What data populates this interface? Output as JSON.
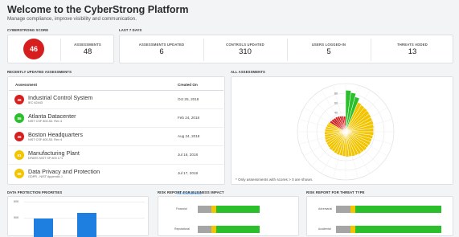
{
  "header": {
    "title": "Welcome to the CyberStrong Platform",
    "subtitle": "Manage compliance, improve visibility and communication."
  },
  "score_card": {
    "label": "CYBERSTRONG SCORE",
    "score": "46",
    "score_color": "#d71e1e",
    "assessments_label": "ASSESSMENTS",
    "assessments_value": "48"
  },
  "last7": {
    "label": "LAST 7 DAYS",
    "stats": [
      {
        "label": "ASSESSMENTS UPDATED",
        "value": "6"
      },
      {
        "label": "CONTROLS UPDATED",
        "value": "310"
      },
      {
        "label": "USERS LOGGED-IN",
        "value": "5"
      },
      {
        "label": "THREATS ADDED",
        "value": "13"
      }
    ]
  },
  "recent": {
    "label": "RECENTLY UPDATED ASSESSMENTS",
    "col_assessment": "Assessment",
    "col_created": "Created On",
    "rows": [
      {
        "score": "36",
        "color": "#d71e1e",
        "name": "Industrial Control System",
        "framework": "IEC 62443",
        "date": "Oct 25, 2018"
      },
      {
        "score": "86",
        "color": "#2bbf2b",
        "name": "Atlanta Datacenter",
        "framework": "NIST CSF 800-53. Rev 4",
        "date": "Feb 24, 2018"
      },
      {
        "score": "36",
        "color": "#d71e1e",
        "name": "Boston Headquarters",
        "framework": "NIST CSF 800-53. Rev 4",
        "date": "Aug 24, 2018"
      },
      {
        "score": "61",
        "color": "#f2c500",
        "name": "Manufacturing Plant",
        "framework": "DFARS NIST SP 800 171",
        "date": "Jul 16, 2018"
      },
      {
        "score": "66",
        "color": "#f2c500",
        "name": "Data Privacy and Protection",
        "framework": "GDPR - NIST Appendix J",
        "date": "Jul 17, 2018"
      }
    ]
  },
  "all_assessments": {
    "label": "ALL ASSESSMENTS",
    "note": "* Only assessments with scores > 0 are shown.",
    "ticks": [
      "80",
      "60",
      "40",
      "20"
    ],
    "colors": {
      "green": "#2bbf2b",
      "yellow": "#f2c500",
      "red": "#d71e1e"
    }
  },
  "bottom": {
    "data_protection_label": "DATA PROTECTION PRIORITIES",
    "risk_business_label": "RISK REPORT FOR BUSINESS IMPACT",
    "risk_business_link": "All Assessments",
    "risk_threat_label": "RISK REPORT FOR THREAT TYPE",
    "dp_ticks": [
      "60K",
      "50K"
    ],
    "business_rows": [
      "Financial",
      "Reputational"
    ],
    "threat_rows": [
      "Adversarial",
      "Accidental"
    ]
  },
  "chart_data": [
    {
      "type": "bar",
      "title": "ALL ASSESSMENTS",
      "polar": true,
      "categories_count": 48,
      "values": [
        86,
        82,
        75,
        66,
        64,
        63,
        62,
        61,
        60,
        60,
        59,
        58,
        58,
        57,
        56,
        56,
        55,
        55,
        54,
        54,
        53,
        53,
        52,
        52,
        51,
        50,
        50,
        49,
        48,
        48,
        47,
        46,
        46,
        45,
        44,
        44,
        43,
        42,
        41,
        40,
        38,
        37,
        36,
        36,
        35,
        34,
        33,
        32
      ],
      "ticks": [
        20,
        40,
        60,
        80
      ],
      "ylim": [
        0,
        100
      ]
    },
    {
      "type": "bar",
      "title": "DATA PROTECTION PRIORITIES",
      "categories": [
        "",
        ""
      ],
      "values": [
        45000,
        48000
      ],
      "ticks": [
        "60K",
        "50K"
      ]
    }
  ]
}
